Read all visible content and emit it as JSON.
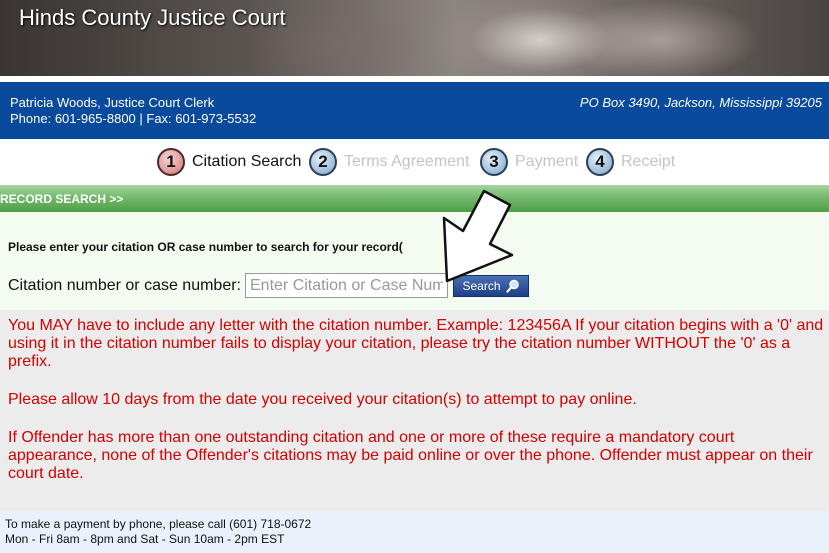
{
  "header": {
    "title": "Hinds County Justice Court"
  },
  "info": {
    "clerk": "Patricia Woods, Justice Court Clerk",
    "contact": "Phone: 601-965-8800 | Fax: 601-973-5532",
    "address": "PO Box 3490, Jackson, Mississippi 39205"
  },
  "steps": [
    {
      "num": "1",
      "label": "Citation Search",
      "state": "active"
    },
    {
      "num": "2",
      "label": "Terms Agreement",
      "state": "inactive"
    },
    {
      "num": "3",
      "label": "Payment",
      "state": "inactive"
    },
    {
      "num": "4",
      "label": "Receipt",
      "state": "inactive"
    }
  ],
  "record_bar": {
    "label": "RECORD SEARCH >>"
  },
  "search": {
    "prompt": "Please enter your citation OR case number to search for your record(",
    "field_label": "Citation number or case number:",
    "placeholder": "Enter Citation or Case Number",
    "button_label": "Search"
  },
  "notices": {
    "p1": "You MAY have to include any letter with the citation number. Example: 123456A If your citation begins with a '0' and using it in the citation number fails to display your citation, please try the citation number WITHOUT the '0' as a prefix.",
    "p2": "Please allow 10 days from the date you received your citation(s) to attempt to pay online.",
    "p3": "If Offender has more than one outstanding citation and one or more of these require a mandatory court appearance, none of the Offender's citations may be paid online or over the phone. Offender must appear on their court date."
  },
  "footer": {
    "line1": "To make a payment by phone, please call (601) 718-0672",
    "line2": "Mon - Fri 8am - 8pm and Sat - Sun 10am - 2pm EST"
  },
  "colors": {
    "info_bar": "#0a4a9c",
    "record_bar": "#6fb767",
    "notice_text": "#d40000",
    "search_button": "#1e3f86"
  },
  "icons": {
    "search_button": "magnifier-icon",
    "overlay": "pointer-arrow-icon"
  }
}
